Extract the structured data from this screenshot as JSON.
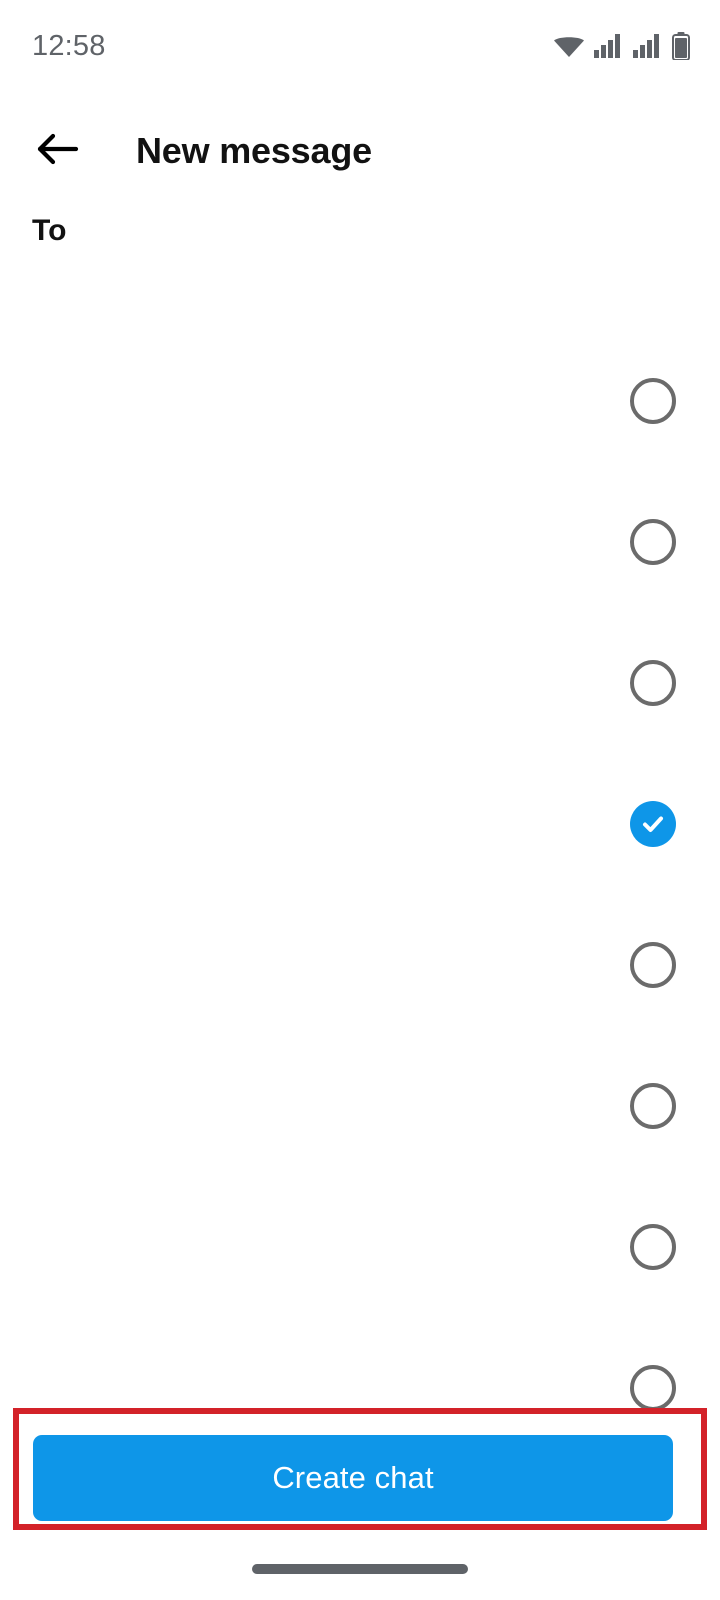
{
  "status_bar": {
    "time": "12:58",
    "icons": [
      {
        "name": "wifi-icon",
        "label": "wifi"
      },
      {
        "name": "signal-icon-sim1",
        "label": "cellular-signal-1"
      },
      {
        "name": "signal-icon-sim2",
        "label": "cellular-signal-2"
      },
      {
        "name": "battery-icon",
        "label": "battery"
      }
    ]
  },
  "app_bar": {
    "back_icon": "back-arrow-icon",
    "title": "New message"
  },
  "recipient_field": {
    "label": "To",
    "value": "",
    "placeholder": ""
  },
  "contact_list": {
    "rows": [
      {
        "name": "",
        "subtitle": "",
        "selected": false
      },
      {
        "name": "",
        "subtitle": "",
        "selected": false
      },
      {
        "name": "",
        "subtitle": "",
        "selected": false
      },
      {
        "name": "",
        "subtitle": "",
        "selected": true
      },
      {
        "name": "",
        "subtitle": "",
        "selected": false
      },
      {
        "name": "",
        "subtitle": "",
        "selected": false
      },
      {
        "name": "",
        "subtitle": "",
        "selected": false
      },
      {
        "name": "",
        "subtitle": "",
        "selected": false
      }
    ],
    "checked_icon": "check-icon",
    "unchecked_icon": "radio-circle-icon"
  },
  "residual_text": "",
  "cta": {
    "label": "Create chat"
  },
  "annotation": {
    "shape": "rectangle",
    "color": "#d32229",
    "target": "create-chat-button"
  },
  "colors": {
    "accent_blue": "#0e96e8",
    "annotation_red": "#d32229",
    "icon_gray": "#5f6368",
    "radio_outline_gray": "#6b6b6b",
    "text_primary": "#121212",
    "background": "#ffffff"
  },
  "gesture_nav": {
    "name": "home-indicator"
  }
}
